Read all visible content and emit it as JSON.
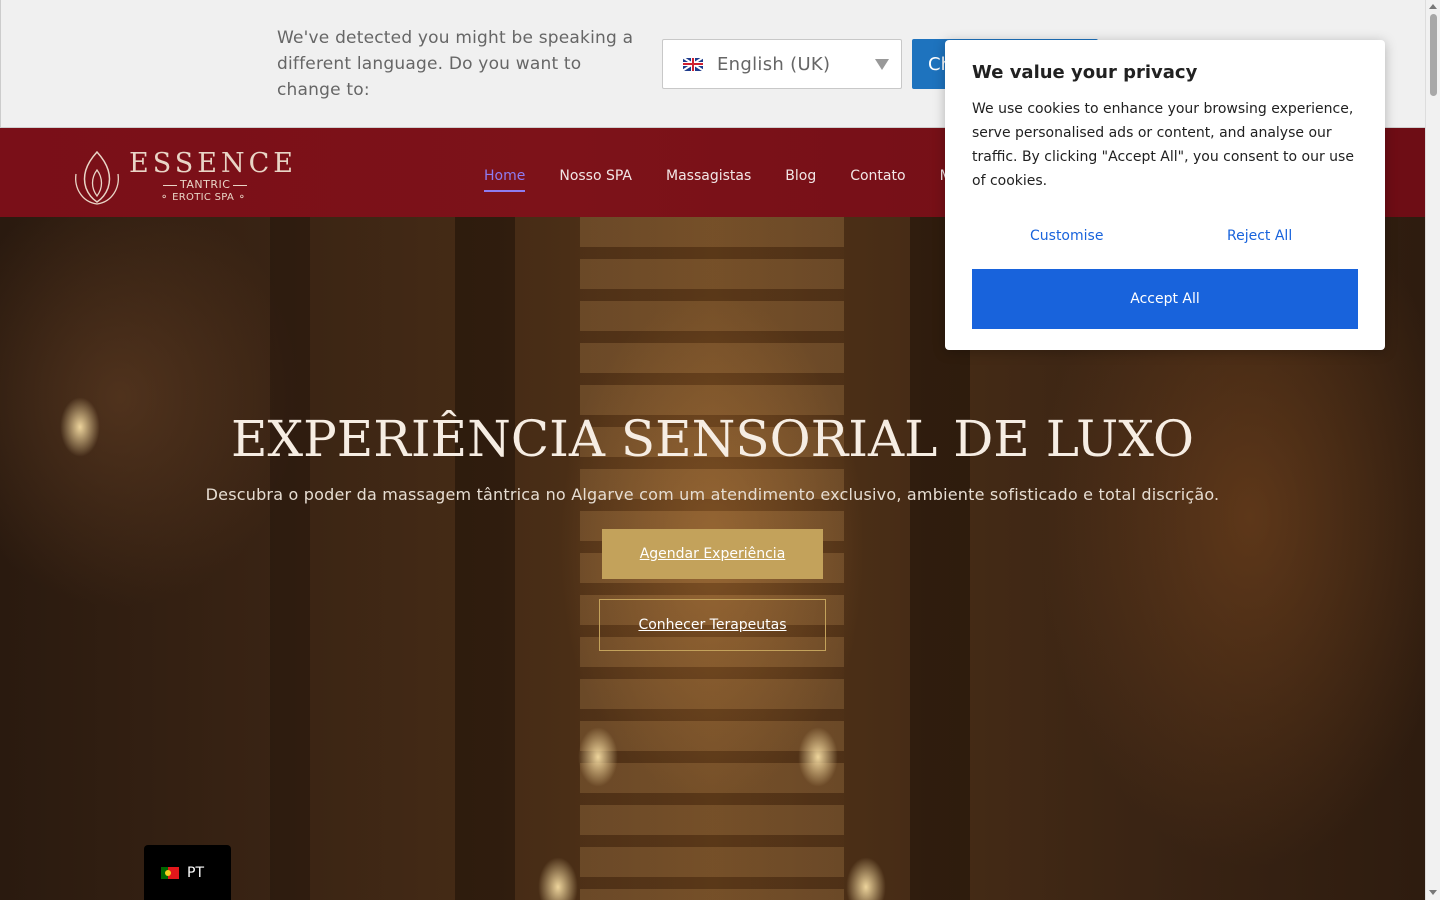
{
  "language_banner": {
    "message": "We've detected you might be speaking a different language. Do you want to change to:",
    "selected_language": "English (UK)",
    "flag_icon": "uk-flag-icon",
    "change_button_label": "Change Language"
  },
  "header": {
    "logo": {
      "brand": "ESSENCE",
      "line1": "TANTRIC",
      "line2": "⚬ EROTIC SPA ⚬"
    },
    "nav": [
      {
        "label": "Home",
        "active": true
      },
      {
        "label": "Nosso SPA",
        "active": false
      },
      {
        "label": "Massagistas",
        "active": false
      },
      {
        "label": "Blog",
        "active": false
      },
      {
        "label": "Contato",
        "active": false
      },
      {
        "label": "M",
        "active": false
      }
    ],
    "active_color": "#8e7cf0"
  },
  "hero": {
    "title": "EXPERIÊNCIA SENSORIAL DE LUXO",
    "subtitle": "Descubra o poder da massagem tântrica no Algarve com um atendimento exclusivo, ambiente sofisticado e total discrição.",
    "primary_cta": "Agendar Experiência",
    "secondary_cta": "Conhecer Terapeutas",
    "accent_color": "#c3a25b"
  },
  "cookie_consent": {
    "title": "We value your privacy",
    "body": "We use cookies to enhance your browsing experience, serve personalised ads or content, and analyse our traffic. By clicking \"Accept All\", you consent to our use of cookies.",
    "customise_label": "Customise",
    "reject_label": "Reject All",
    "accept_label": "Accept All",
    "accent_color": "#1863dc"
  },
  "language_switcher": {
    "label": "PT",
    "flag_icon": "portugal-flag-icon"
  }
}
